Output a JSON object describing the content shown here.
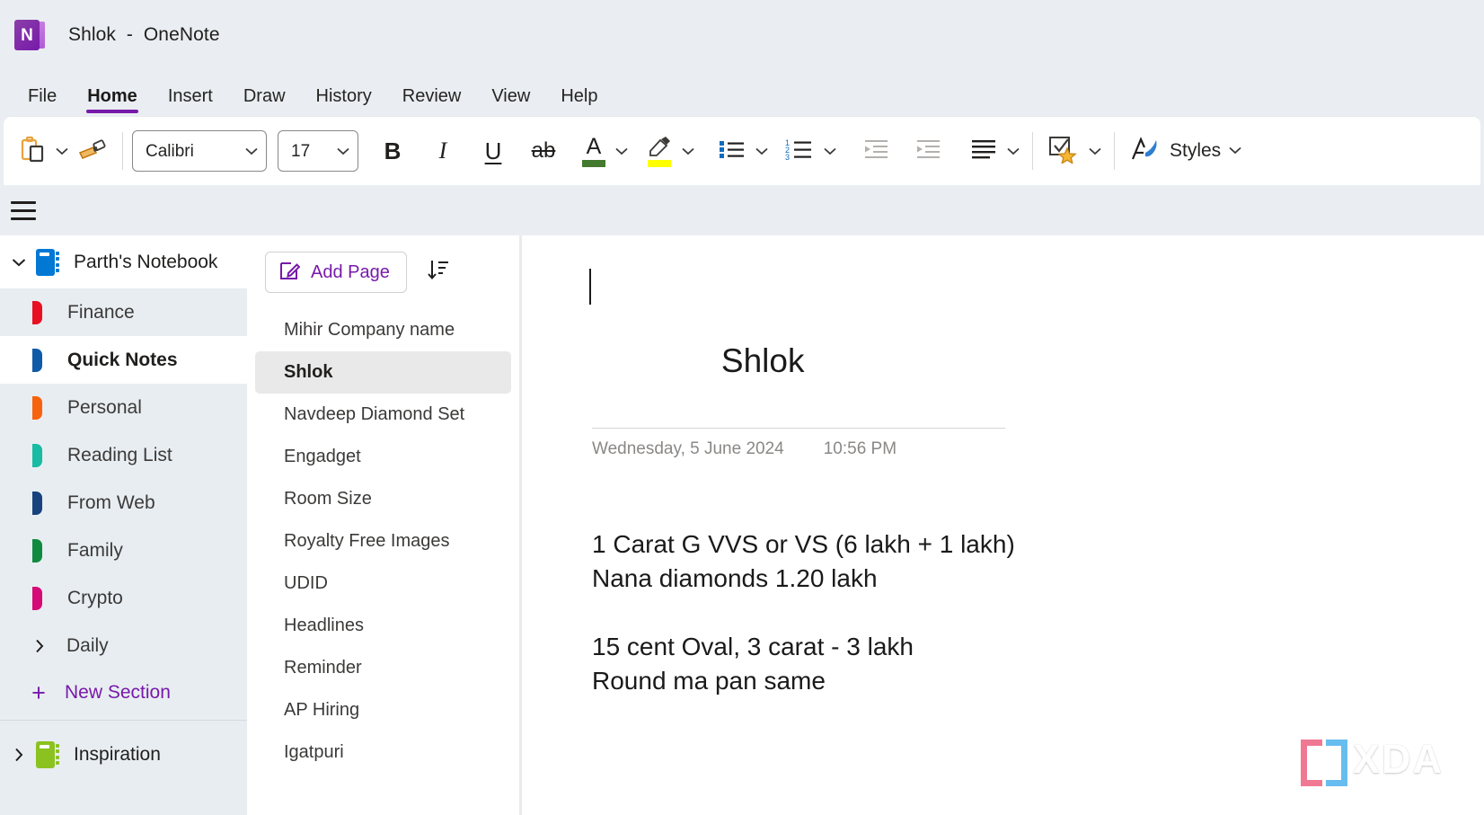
{
  "window": {
    "title": "Shlok  -  OneNote",
    "app_logo_letter": "N",
    "logo_color": "#7719aa"
  },
  "tabs": [
    {
      "label": "File",
      "active": false
    },
    {
      "label": "Home",
      "active": true
    },
    {
      "label": "Insert",
      "active": false
    },
    {
      "label": "Draw",
      "active": false
    },
    {
      "label": "History",
      "active": false
    },
    {
      "label": "Review",
      "active": false
    },
    {
      "label": "View",
      "active": false
    },
    {
      "label": "Help",
      "active": false
    }
  ],
  "ribbon": {
    "accent": "#7719aa",
    "paste_icon": "paste-icon",
    "format_painter_icon": "format-painter-icon",
    "font_name": "Calibri",
    "font_size": "17",
    "bold": "B",
    "italic": "I",
    "underline": "U",
    "strikethrough": "ab",
    "font_color_glyph": "A",
    "font_color": "#447a2f",
    "highlight_color": "#ffff00",
    "bullets_icon": "bulleted-list-icon",
    "numbering_icon": "numbered-list-icon",
    "decrease_indent_icon": "decrease-indent-icon",
    "increase_indent_icon": "increase-indent-icon",
    "align_icon": "align-left-icon",
    "tags_icon": "tags-icon",
    "styles_icon": "styles-icon",
    "styles_label": "Styles"
  },
  "navigation": {
    "hamburger_icon": "hamburger-menu-icon"
  },
  "sidebar": {
    "notebooks": [
      {
        "name": "Parth's Notebook",
        "color": "#0078d4",
        "expanded": true,
        "sections": [
          {
            "label": "Finance",
            "color": "#e81123",
            "selected": false,
            "type": "section"
          },
          {
            "label": "Quick Notes",
            "color": "#0f5ba7",
            "selected": true,
            "type": "section"
          },
          {
            "label": "Personal",
            "color": "#f7630c",
            "selected": false,
            "type": "section"
          },
          {
            "label": "Reading List",
            "color": "#18bba4",
            "selected": false,
            "type": "section"
          },
          {
            "label": "From Web",
            "color": "#17427e",
            "selected": false,
            "type": "section"
          },
          {
            "label": "Family",
            "color": "#0f8a3f",
            "selected": false,
            "type": "section"
          },
          {
            "label": "Crypto",
            "color": "#d60a76",
            "selected": false,
            "type": "section"
          },
          {
            "label": "Daily",
            "color": "",
            "selected": false,
            "type": "group"
          }
        ],
        "new_section_label": "New Section"
      },
      {
        "name": "Inspiration",
        "color": "#8cc220",
        "expanded": false,
        "sections": [],
        "new_section_label": ""
      }
    ]
  },
  "pagelist": {
    "add_page_label": "Add Page",
    "add_page_icon": "new-page-icon",
    "sort_icon": "sort-descending-icon",
    "pages": [
      {
        "title": "Mihir Company name",
        "selected": false
      },
      {
        "title": "Shlok",
        "selected": true
      },
      {
        "title": "Navdeep Diamond Set",
        "selected": false
      },
      {
        "title": "Engadget",
        "selected": false
      },
      {
        "title": "Room Size",
        "selected": false
      },
      {
        "title": "Royalty Free Images",
        "selected": false
      },
      {
        "title": "UDID",
        "selected": false
      },
      {
        "title": "Headlines",
        "selected": false
      },
      {
        "title": "Reminder",
        "selected": false
      },
      {
        "title": "AP Hiring",
        "selected": false
      },
      {
        "title": "Igatpuri",
        "selected": false
      }
    ]
  },
  "page": {
    "title": "Shlok",
    "date": "Wednesday, 5 June 2024",
    "time": "10:56 PM",
    "lines": [
      "1 Carat G VVS or VS (6 lakh + 1 lakh)",
      "Nana diamonds 1.20 lakh",
      "",
      "15 cent Oval, 3 carat - 3 lakh",
      "Round ma pan same"
    ]
  },
  "watermark": {
    "text": "XDA",
    "bracket_left_color": "#f06d8a",
    "bracket_right_color": "#5bb8ee"
  }
}
